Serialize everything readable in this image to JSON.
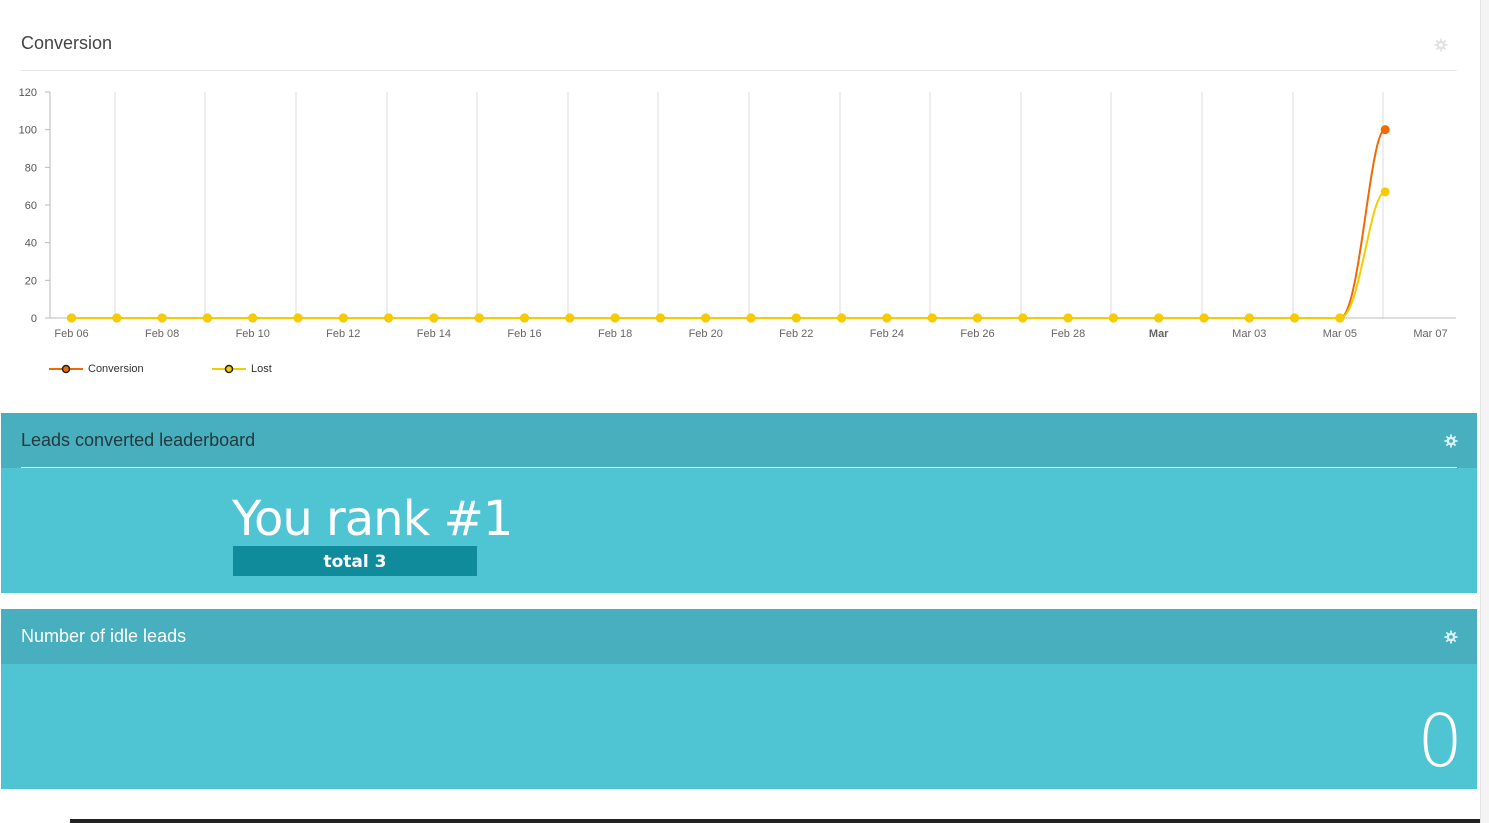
{
  "conversion_widget": {
    "title": "Conversion",
    "gear_icon": "gear-icon"
  },
  "chart_data": {
    "type": "line",
    "title": "",
    "xlabel": "",
    "ylabel": "",
    "ylim": [
      0,
      120
    ],
    "y_ticks": [
      "0",
      "20",
      "40",
      "60",
      "80",
      "100",
      "120"
    ],
    "x_tick_labels": [
      "Feb 06",
      "Feb 08",
      "Feb 10",
      "Feb 12",
      "Feb 14",
      "Feb 16",
      "Feb 18",
      "Feb 20",
      "Feb 22",
      "Feb 24",
      "Feb 26",
      "Feb 28",
      "Mar",
      "Mar 03",
      "Mar 05",
      "Mar 07"
    ],
    "x": [
      "Feb 06",
      "Feb 07",
      "Feb 08",
      "Feb 09",
      "Feb 10",
      "Feb 11",
      "Feb 12",
      "Feb 13",
      "Feb 14",
      "Feb 15",
      "Feb 16",
      "Feb 17",
      "Feb 18",
      "Feb 19",
      "Feb 20",
      "Feb 21",
      "Feb 22",
      "Feb 23",
      "Feb 24",
      "Feb 25",
      "Feb 26",
      "Feb 27",
      "Feb 28",
      "Mar 01",
      "Mar 02",
      "Mar 03",
      "Mar 04",
      "Mar 05",
      "Mar 06",
      "Mar 07"
    ],
    "series": [
      {
        "name": "Conversion",
        "color": "#ee6a06",
        "values": [
          0,
          0,
          0,
          0,
          0,
          0,
          0,
          0,
          0,
          0,
          0,
          0,
          0,
          0,
          0,
          0,
          0,
          0,
          0,
          0,
          0,
          0,
          0,
          0,
          0,
          0,
          0,
          0,
          0,
          100
        ]
      },
      {
        "name": "Lost",
        "color": "#f5cc00",
        "values": [
          0,
          0,
          0,
          0,
          0,
          0,
          0,
          0,
          0,
          0,
          0,
          0,
          0,
          0,
          0,
          0,
          0,
          0,
          0,
          0,
          0,
          0,
          0,
          0,
          0,
          0,
          0,
          0,
          0,
          67
        ]
      }
    ],
    "grid": true,
    "legend": "bottom-left"
  },
  "leaderboard_widget": {
    "title": "Leads converted leaderboard",
    "rank_text": "You rank #1",
    "total_text": "total 3",
    "gear_icon": "gear-icon"
  },
  "idle_widget": {
    "title": "Number of idle leads",
    "count": "0",
    "gear_icon": "gear-icon"
  },
  "colors": {
    "teal_header": "#47afbe",
    "teal_body": "#4fc5d4",
    "badge": "#108b9b"
  }
}
